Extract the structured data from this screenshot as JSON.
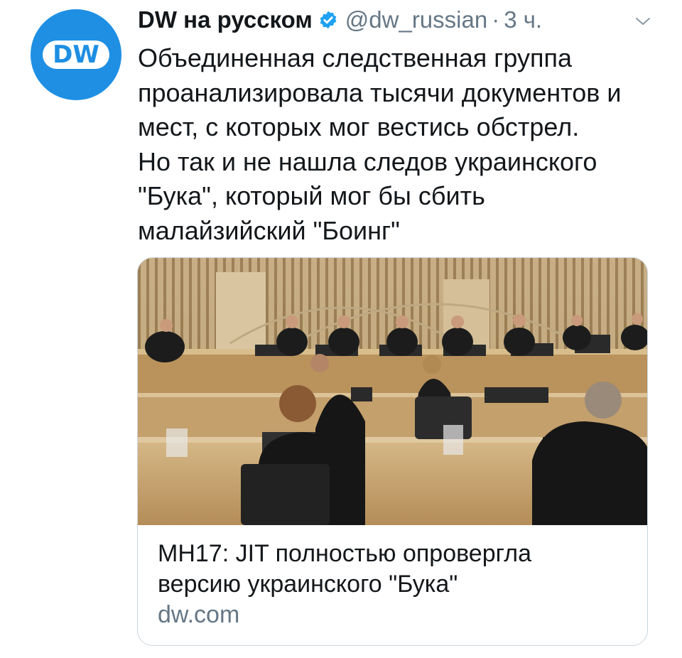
{
  "tweet": {
    "author_name": "DW на русском",
    "handle": "@dw_russian",
    "separator": "·",
    "time": "3 ч.",
    "avatar_text": "DW",
    "text_lines": [
      "Объединенная следственная группа",
      "проанализировала тысячи документов и",
      "мест, с которых мог вестись обстрел.",
      "Но так и не нашла следов украинского",
      "\"Бука\", который мог бы сбить",
      "малайзийский \"Боинг\""
    ]
  },
  "card": {
    "image_label": "courtroom-photo",
    "title_lines": [
      "MH17: JIT полностью опровергла",
      "версию украинского \"Бука\""
    ],
    "domain": "dw.com"
  },
  "colors": {
    "avatar_blue": "#1e8fe3",
    "verified_blue": "#1da1f2",
    "secondary_text": "#657786",
    "card_border": "#ccd6dd"
  },
  "icons": {
    "verified": "verified-badge-icon",
    "caret": "chevron-down-icon"
  }
}
